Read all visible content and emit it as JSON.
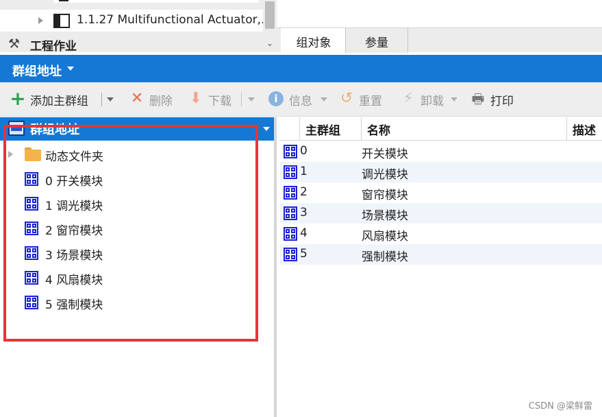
{
  "topTree": {
    "device_label": "1.1.27 Multifunctional Actuator,...",
    "section_label": "工程作业"
  },
  "tabs": [
    {
      "label": "组对象"
    },
    {
      "label": "参量"
    }
  ],
  "header": {
    "title": "群组地址"
  },
  "toolbar": {
    "add_main_group": "添加主群组",
    "delete": "删除",
    "download": "下载",
    "info": "信息",
    "reset": "重置",
    "unload": "卸载",
    "print": "打印"
  },
  "tree": {
    "header_title": "群组地址",
    "items": [
      {
        "label": "动态文件夹"
      },
      {
        "label": "0 开关模块"
      },
      {
        "label": "1 调光模块"
      },
      {
        "label": "2 窗帘模块"
      },
      {
        "label": "3 场景模块"
      },
      {
        "label": "4 风扇模块"
      },
      {
        "label": "5 强制模块"
      }
    ]
  },
  "table": {
    "columns": [
      "主群组",
      "名称",
      "描述"
    ],
    "rows": [
      {
        "main": "0",
        "name": "开关模块"
      },
      {
        "main": "1",
        "name": "调光模块"
      },
      {
        "main": "2",
        "name": "窗帘模块"
      },
      {
        "main": "3",
        "name": "场景模块"
      },
      {
        "main": "4",
        "name": "风扇模块"
      },
      {
        "main": "5",
        "name": "强制模块"
      }
    ]
  },
  "watermark": "CSDN @梁鲜雷",
  "colors": {
    "accent_blue": "#1478d4",
    "highlight_red": "#e8323c",
    "group_icon": "#1a1fd6"
  }
}
